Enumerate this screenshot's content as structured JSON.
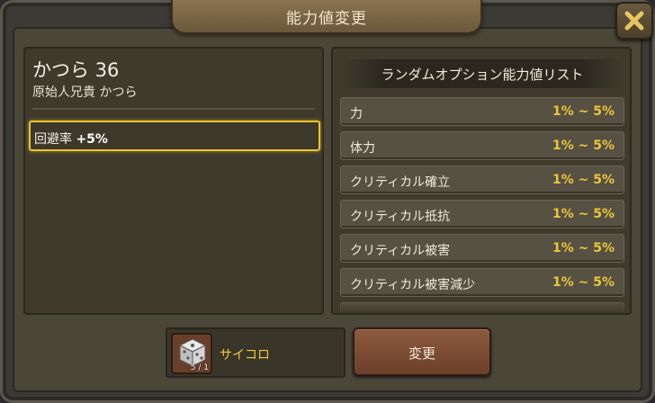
{
  "dialog": {
    "title": "能力値変更"
  },
  "character": {
    "name": "かつら 36",
    "subtitle": "原始人兄貴 かつら",
    "current_stat": {
      "label": "回避率",
      "value": "+5%"
    }
  },
  "option_list": {
    "header": "ランダムオプション能力値リスト",
    "items": [
      {
        "name": "力",
        "range": "1% ~ 5%"
      },
      {
        "name": "体力",
        "range": "1% ~ 5%"
      },
      {
        "name": "クリティカル確立",
        "range": "1% ~ 5%"
      },
      {
        "name": "クリティカル抵抗",
        "range": "1% ~ 5%"
      },
      {
        "name": "クリティカル被害",
        "range": "1% ~ 5%"
      },
      {
        "name": "クリティカル被害減少",
        "range": "1% ~ 5%"
      }
    ]
  },
  "item": {
    "name": "サイコロ",
    "count": "5 / 1",
    "icon": "dice-icon"
  },
  "buttons": {
    "change": "変更",
    "close_icon": "close-icon"
  },
  "colors": {
    "accent_gold": "#e9c63a",
    "highlight_border": "#e8c52c",
    "button_brown": "#8c5a3e"
  }
}
